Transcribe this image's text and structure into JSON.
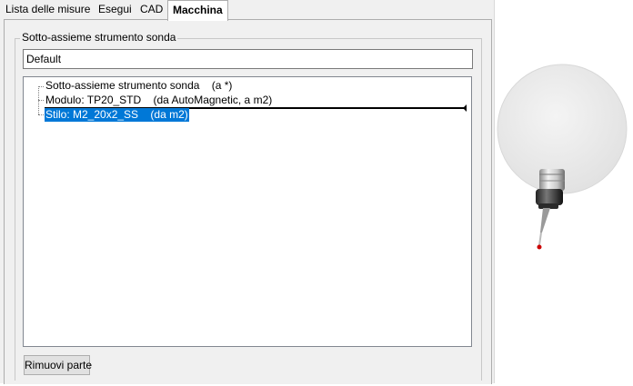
{
  "tabs": [
    {
      "label": "Lista delle misure",
      "active": false
    },
    {
      "label": "Esegui",
      "active": false
    },
    {
      "label": "CAD",
      "active": false
    },
    {
      "label": "Macchina",
      "active": true
    }
  ],
  "group": {
    "title": "Sotto-assieme strumento sonda",
    "name_value": "Default"
  },
  "tree": {
    "items": [
      {
        "label": "Sotto-assieme strumento sonda    (a *)",
        "selected": false
      },
      {
        "label": "Modulo: TP20_STD    (da AutoMagnetic, a m2)",
        "selected": false
      },
      {
        "label": "Stilo: M2_20x2_SS    (da m2)",
        "selected": true
      }
    ]
  },
  "buttons": {
    "remove_part": "Rimuovi parte"
  },
  "colors": {
    "selection": "#0078d7",
    "stylus_tip": "#cc0000"
  }
}
